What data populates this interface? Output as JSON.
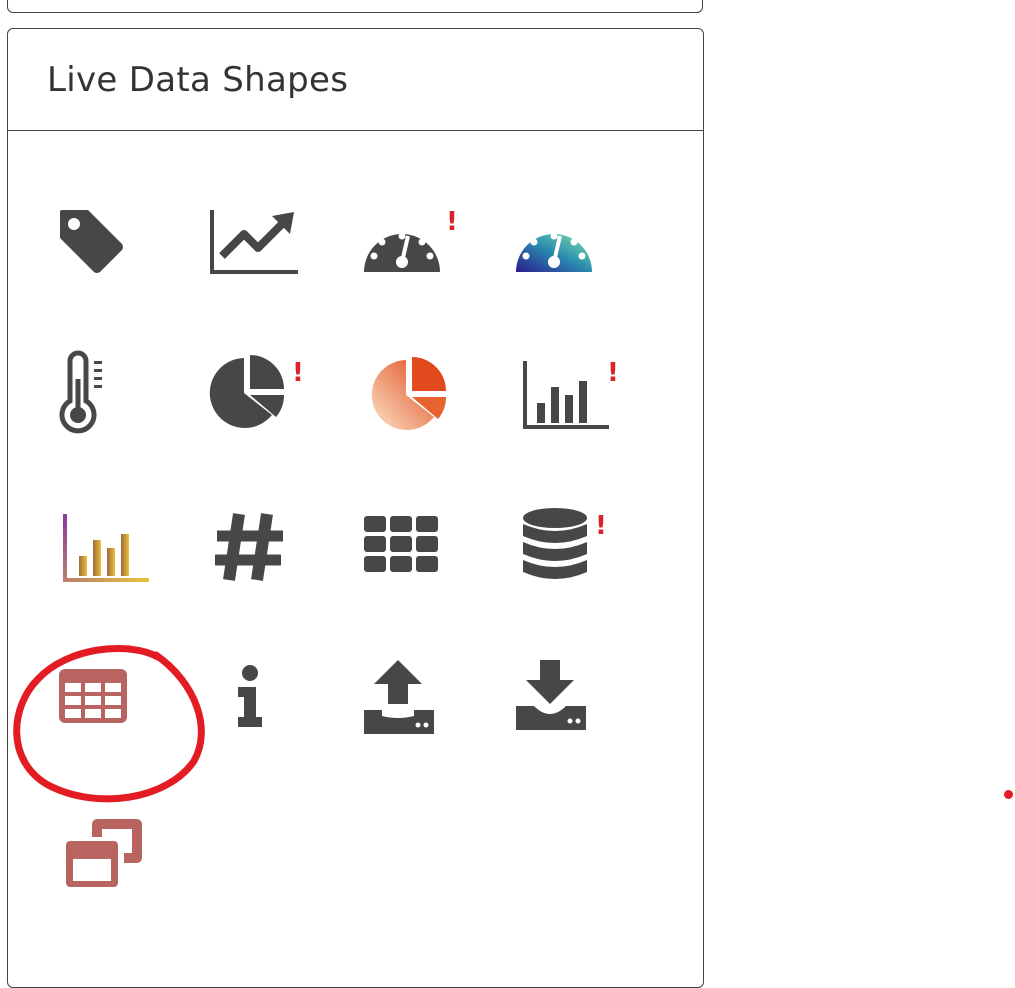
{
  "panel": {
    "title": "Live Data Shapes"
  },
  "shapes": [
    {
      "name": "tag-icon"
    },
    {
      "name": "line-chart-icon"
    },
    {
      "name": "gauge-alert-icon",
      "badge": "!"
    },
    {
      "name": "gauge-gradient-icon"
    },
    {
      "name": "thermometer-icon"
    },
    {
      "name": "pie-chart-alert-icon",
      "badge": "!"
    },
    {
      "name": "pie-chart-gradient-icon"
    },
    {
      "name": "bar-chart-alert-icon",
      "badge": "!"
    },
    {
      "name": "bar-chart-gradient-icon"
    },
    {
      "name": "hashtag-icon"
    },
    {
      "name": "grid-icon"
    },
    {
      "name": "database-alert-icon",
      "badge": "!"
    },
    {
      "name": "table-icon"
    },
    {
      "name": "info-icon"
    },
    {
      "name": "upload-icon"
    },
    {
      "name": "download-icon"
    },
    {
      "name": "window-restore-icon"
    }
  ],
  "colors": {
    "icon": "#474747",
    "alert": "#d9232a",
    "table": "#b86461",
    "annotation": "#e31b23"
  }
}
